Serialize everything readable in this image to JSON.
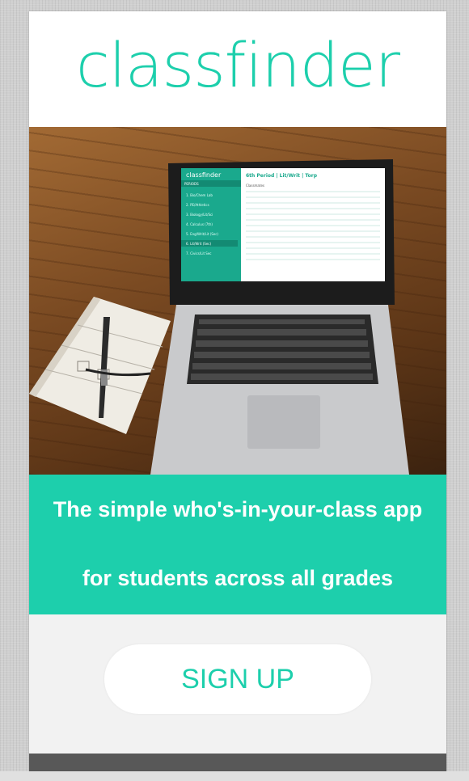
{
  "brand": {
    "logo_text": "classfinder",
    "accent_color": "#1dcfac"
  },
  "hero": {
    "laptop_app": {
      "logo": "classfinder",
      "title": "6th Period | Lit/Writ | Torp",
      "sidebar_header": "PERIODS",
      "sidebar_items": [
        "1. Bio/Chem Lab",
        "2. PE/Athletics",
        "3. Biology/Lit/Sci",
        "4. Calculus (7th)",
        "5. Eng/Writ/Lit (Sec)",
        "6. Lit/Writ (Sec)",
        "7. Civics/Lit Sec"
      ],
      "column_header": "Classmates"
    }
  },
  "banner": {
    "line1": "The simple who's-in-your-class app",
    "line2": "for students across all grades"
  },
  "cta": {
    "signup_label": "SIGN UP"
  }
}
